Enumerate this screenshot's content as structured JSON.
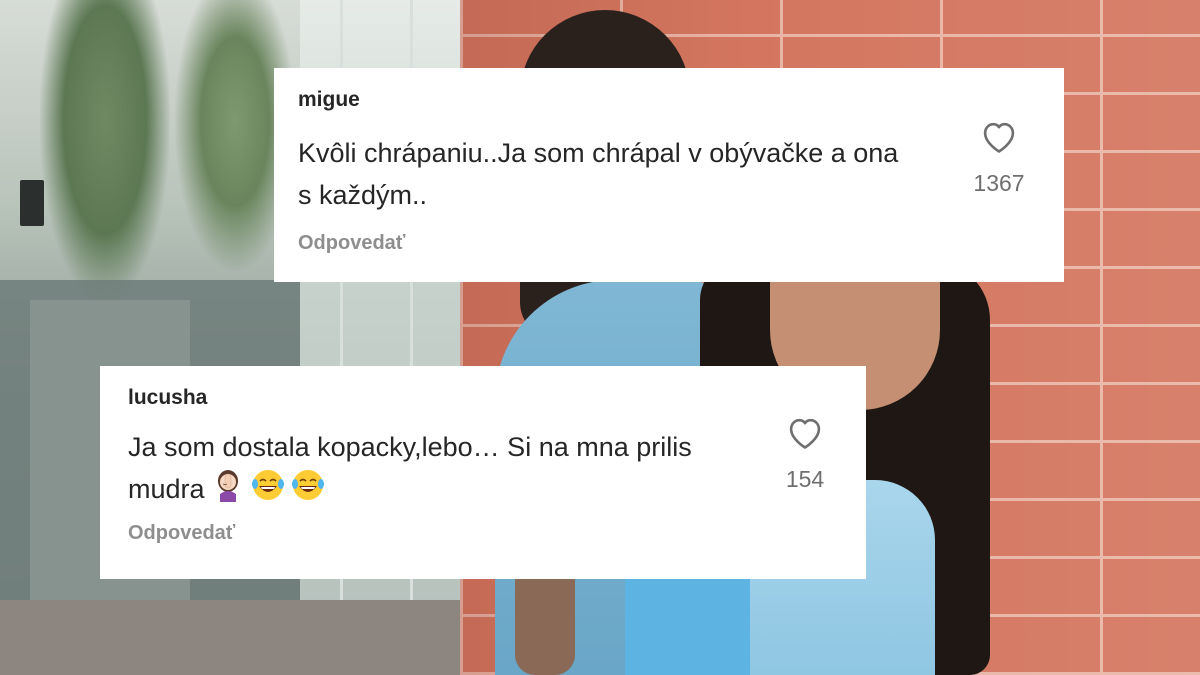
{
  "comments": [
    {
      "username": "migue",
      "text": "Kvôli chrápaniu..Ja som chrápal v obývačke a ona s každým..",
      "likes": "1367",
      "reply_label": "Odpovedať"
    },
    {
      "username": "lucusha",
      "text": "Ja som dostala kopacky,lebo… Si na mna prilis mudra",
      "emojis": [
        "woman-facepalming",
        "face-with-tears-of-joy",
        "face-with-tears-of-joy"
      ],
      "likes": "154",
      "reply_label": "Odpovedať"
    }
  ],
  "colors": {
    "card_bg": "#ffffff",
    "username": "#262626",
    "reply": "#8e8e8e",
    "likes": "#6f6f6f"
  }
}
